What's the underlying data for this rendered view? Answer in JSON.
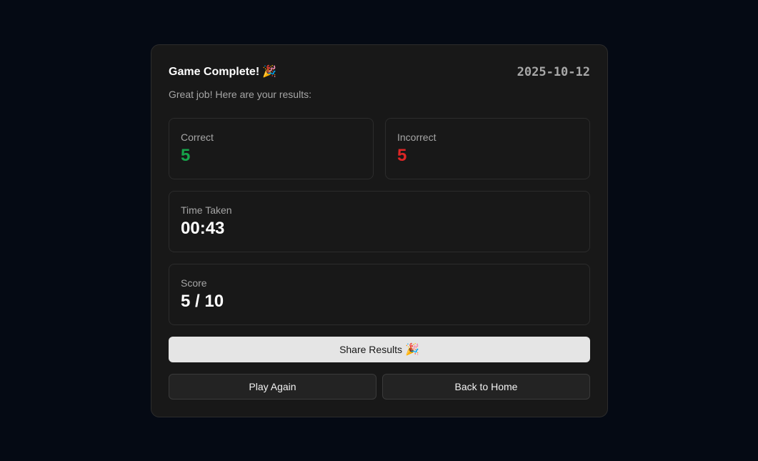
{
  "header": {
    "title": "Game Complete!",
    "title_emoji": "🎉",
    "date": "2025-10-12",
    "subtitle": "Great job! Here are your results:"
  },
  "stats": {
    "correct": {
      "label": "Correct",
      "value": "5",
      "color": "#16a34a"
    },
    "incorrect": {
      "label": "Incorrect",
      "value": "5",
      "color": "#dc2626"
    },
    "time": {
      "label": "Time Taken",
      "value": "00:43"
    },
    "score": {
      "label": "Score",
      "value": "5 / 10"
    }
  },
  "actions": {
    "share_label": "Share Results",
    "share_emoji": "🎉",
    "play_again_label": "Play Again",
    "back_home_label": "Back to Home"
  },
  "colors": {
    "background": "#050a14",
    "card": "#181818",
    "primary_button": "#e5e5e5"
  }
}
